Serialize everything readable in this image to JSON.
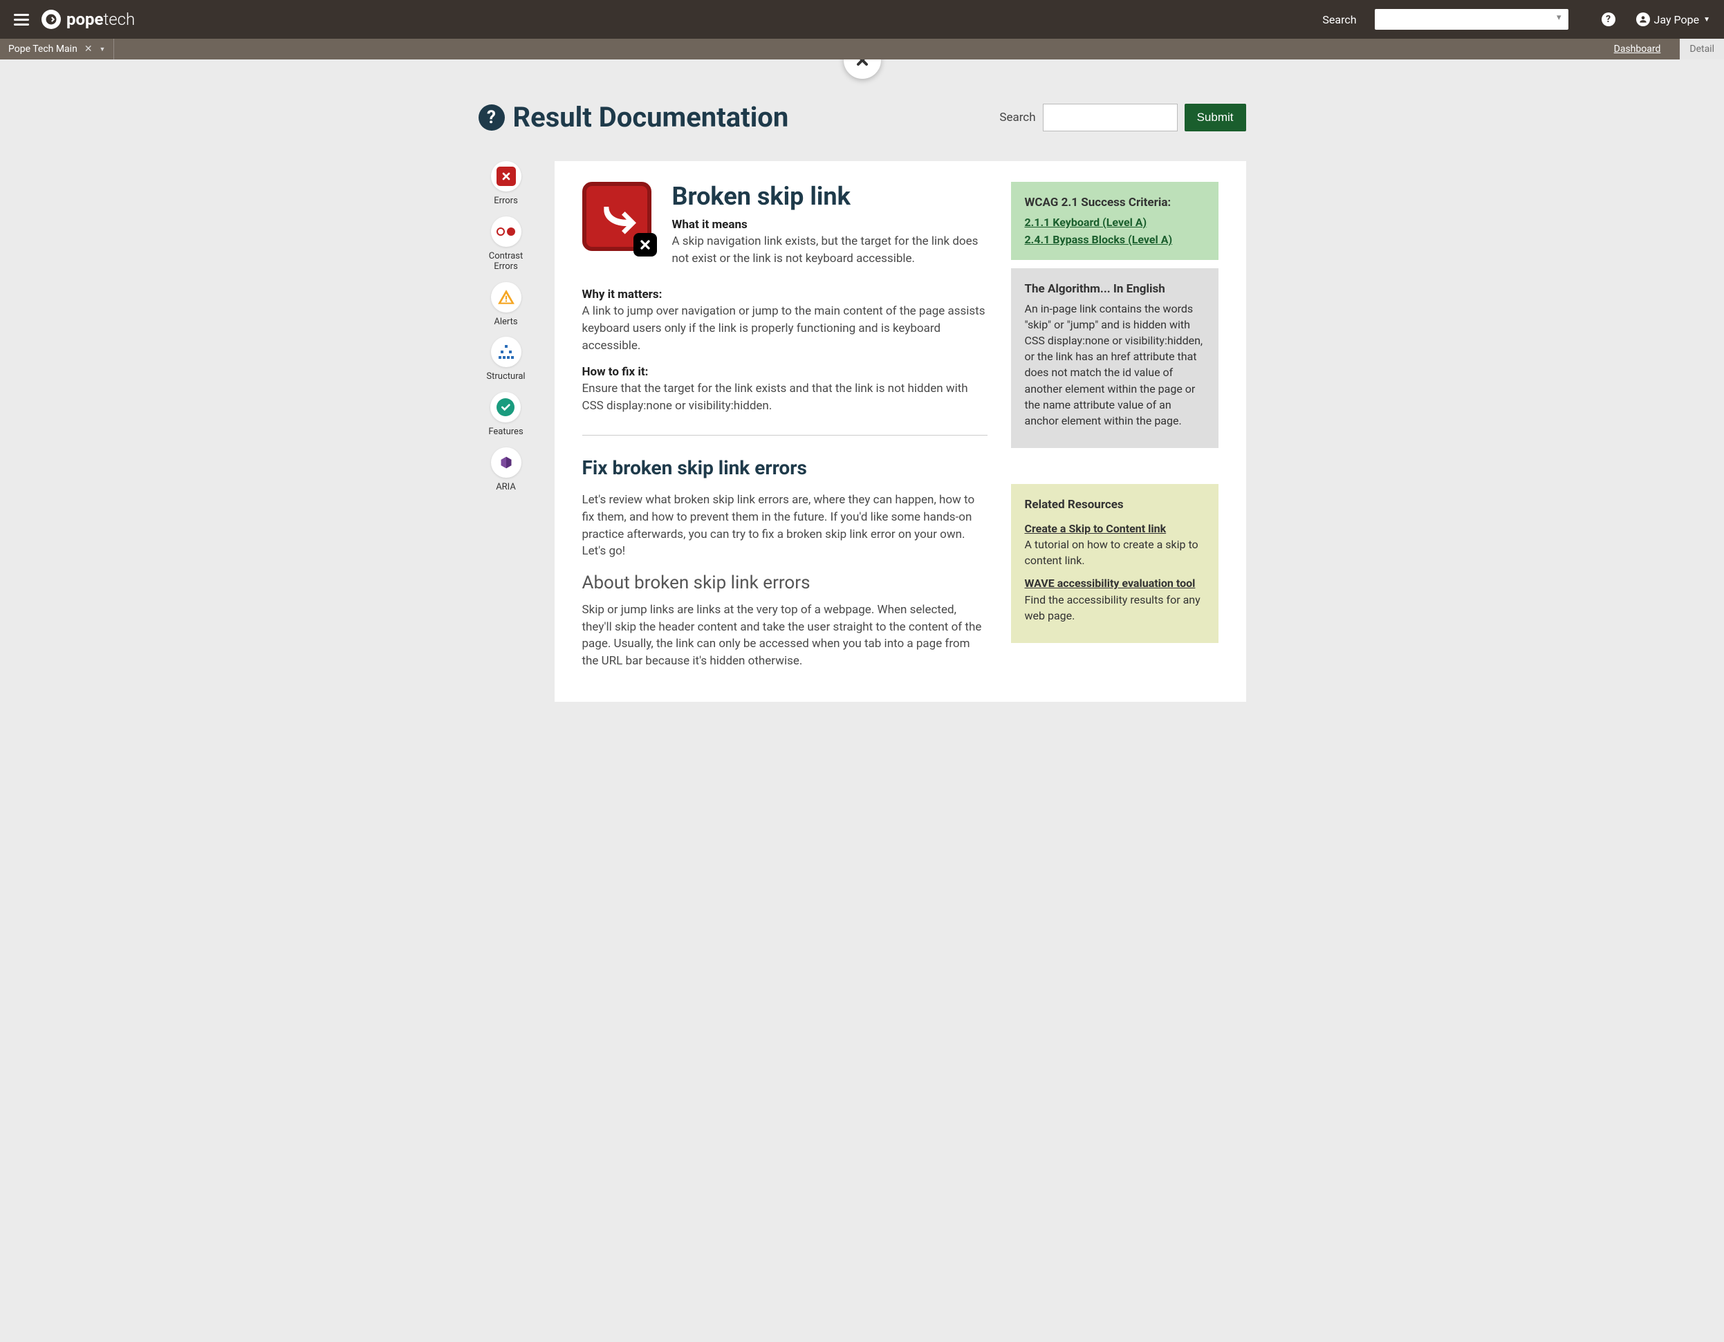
{
  "appbar": {
    "brand_prefix": "pope",
    "brand_suffix": "tech",
    "search_label": "Search",
    "user_name": "Jay Pope"
  },
  "tabs": {
    "items": [
      {
        "label": "Pope Tech Main"
      }
    ],
    "crumbs": [
      {
        "label": "Dashboard"
      },
      {
        "label": "Detail"
      }
    ]
  },
  "page": {
    "title": "Result Documentation",
    "search_label": "Search",
    "submit": "Submit"
  },
  "rail": [
    {
      "label": "Errors",
      "icon": "error"
    },
    {
      "label": "Contrast Errors",
      "icon": "contrast"
    },
    {
      "label": "Alerts",
      "icon": "alert"
    },
    {
      "label": "Structural",
      "icon": "structure"
    },
    {
      "label": "Features",
      "icon": "feature"
    },
    {
      "label": "ARIA",
      "icon": "aria"
    }
  ],
  "doc": {
    "title": "Broken skip link",
    "means_label": "What it means",
    "means": "A skip navigation link exists, but the target for the link does not exist or the link is not keyboard accessible.",
    "matters_label": "Why it matters:",
    "matters": "A link to jump over navigation or jump to the main content of the page assists keyboard users only if the link is properly functioning and is keyboard accessible.",
    "fix_label": "How to fix it:",
    "fix": "Ensure that the target for the link exists and that the link is not hidden with CSS display:none or visibility:hidden."
  },
  "wcag": {
    "heading": "WCAG 2.1 Success Criteria:",
    "links": [
      "2.1.1 Keyboard (Level A)",
      "2.4.1 Bypass Blocks (Level A)"
    ]
  },
  "algo": {
    "heading": "The Algorithm... In English",
    "body": "An in-page link contains the words \"skip\" or \"jump\" and is hidden with CSS display:none or visibility:hidden, or the link has an href attribute that does not match the id value of another element within the page or the name attribute value of an anchor element within the page."
  },
  "guide": {
    "heading": "Fix broken skip link errors",
    "intro": "Let's review what broken skip link errors are, where they can happen, how to fix them, and how to prevent them in the future. If you'd like some hands-on practice afterwards, you can try to fix a broken skip link error on your own. Let's go!",
    "about_heading": "About broken skip link errors",
    "about": "Skip or jump links are links at the very top of a webpage. When selected, they'll skip the header content and take the user straight to the content of the page. Usually, the link can only be accessed when you tab into a page from the URL bar because it's hidden otherwise."
  },
  "related": {
    "heading": "Related Resources",
    "items": [
      {
        "title": "Create a Skip to Content link",
        "desc": "A tutorial on how to create a skip to content link."
      },
      {
        "title": "WAVE accessibility evaluation tool",
        "desc": "Find the accessibility results for any web page."
      }
    ]
  }
}
